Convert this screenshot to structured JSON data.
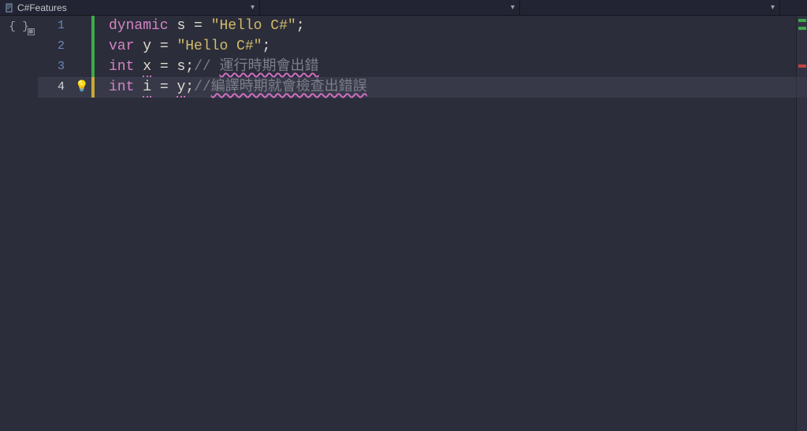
{
  "tabs": [
    {
      "title": "C#Features"
    },
    {
      "title": ""
    },
    {
      "title": ""
    }
  ],
  "code": {
    "lines": [
      {
        "num": "1",
        "bar": "green",
        "kw": "dynamic",
        "ident": "s",
        "assign": " = ",
        "str": "\"Hello C#\"",
        "end": ";"
      },
      {
        "num": "2",
        "bar": "green",
        "kw": "var",
        "ident": "y",
        "assign": " = ",
        "str": "\"Hello C#\"",
        "end": ";"
      },
      {
        "num": "3",
        "bar": "green",
        "kw": "int",
        "ident": "x",
        "assign": " = ",
        "rhs": "s",
        "end": ";",
        "commentSlash": "// ",
        "comment": "運行時期會出錯"
      },
      {
        "num": "4",
        "bar": "yellow",
        "kw": "int",
        "ident": "i",
        "assign": " = ",
        "rhs": "y",
        "end": ";",
        "commentSlash": "//",
        "comment": "編譯時期就會檢查出錯誤"
      }
    ]
  }
}
